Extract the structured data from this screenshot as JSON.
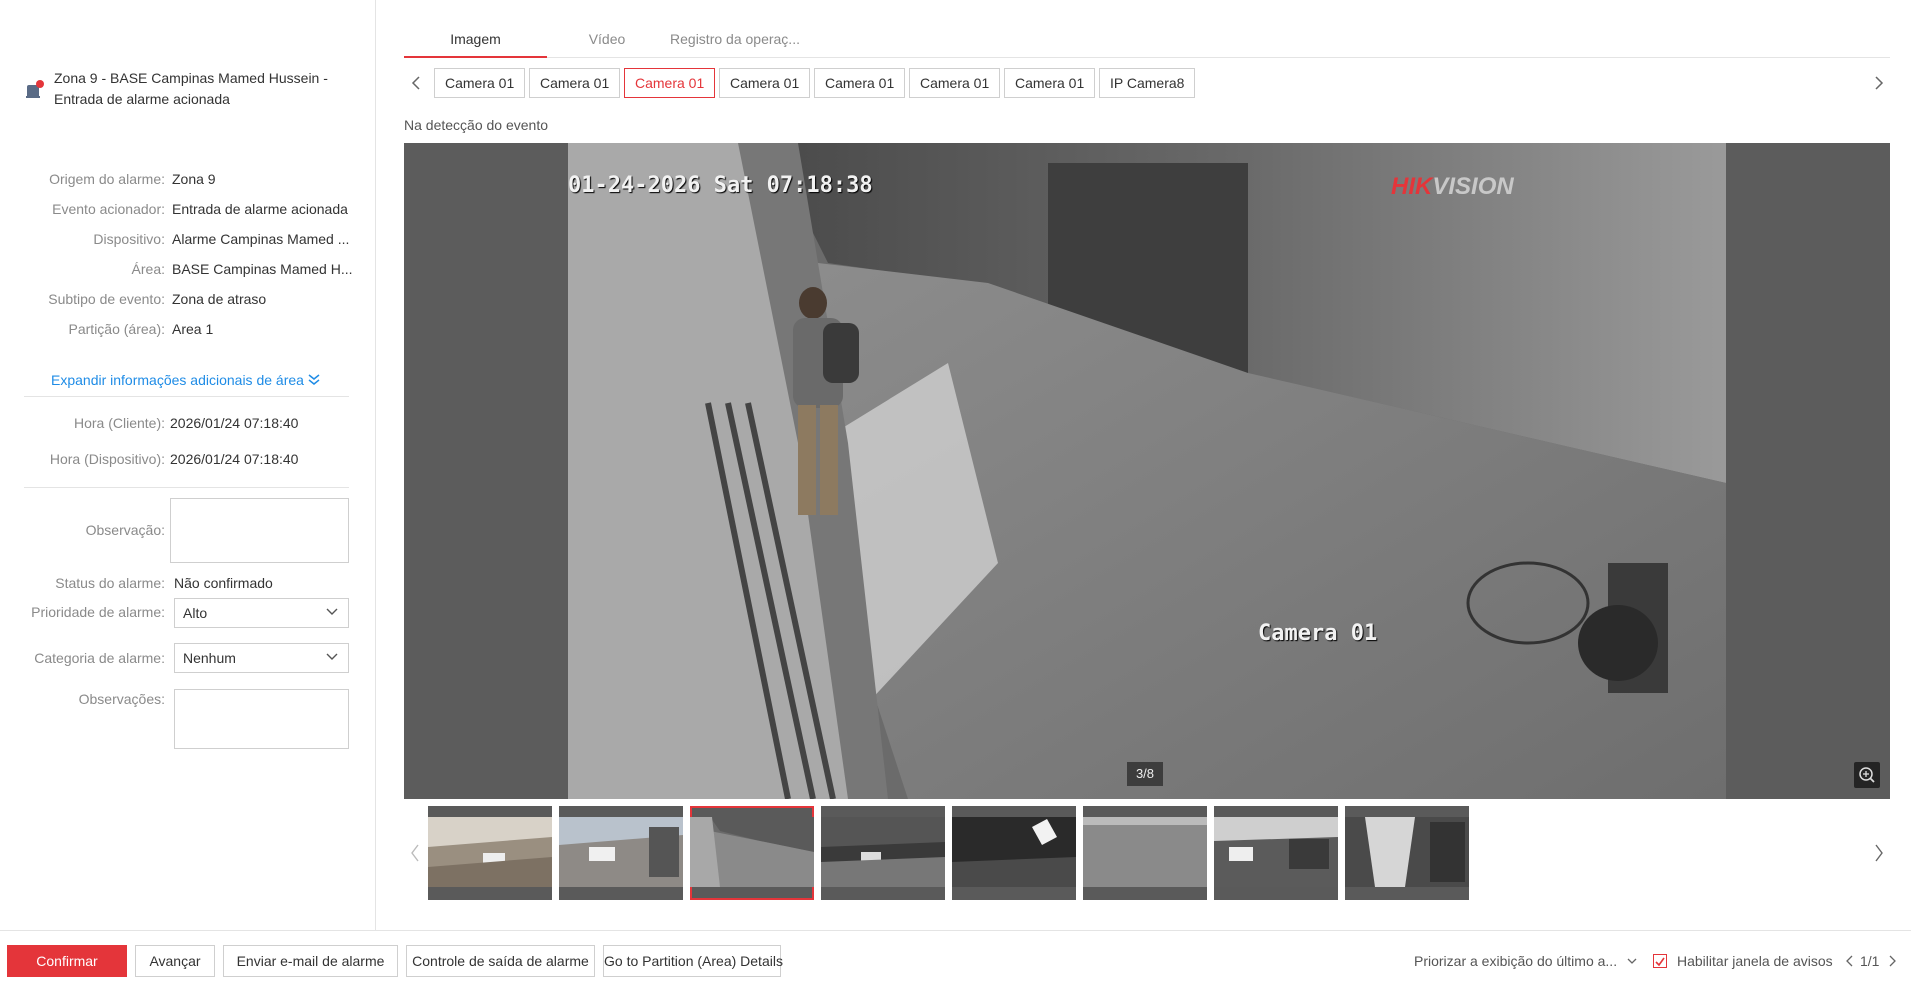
{
  "alarm": {
    "title_line1": "Zona 9 - BASE Campinas Mamed Hussein -",
    "title_line2": "Entrada de alarme acionada"
  },
  "details": [
    {
      "label": "Origem do alarme:",
      "value": "Zona 9"
    },
    {
      "label": "Evento acionador:",
      "value": "Entrada de alarme acionada"
    },
    {
      "label": "Dispositivo:",
      "value": "Alarme Campinas Mamed ..."
    },
    {
      "label": "Área:",
      "value": "BASE Campinas Mamed H..."
    },
    {
      "label": "Subtipo de evento:",
      "value": "Zona de atraso"
    },
    {
      "label": "Partição (área):",
      "value": "Area 1"
    }
  ],
  "expand_link": "Expandir informações adicionais de área",
  "times": [
    {
      "label": "Hora (Cliente):",
      "value": "2026/01/24 07:18:40"
    },
    {
      "label": "Hora (Dispositivo):",
      "value": "2026/01/24 07:18:40"
    }
  ],
  "form": {
    "observacao_label": "Observação:",
    "observacao_value": "",
    "status_label": "Status do alarme:",
    "status_value": "Não confirmado",
    "priority_label": "Prioridade de alarme:",
    "priority_value": "Alto",
    "category_label": "Categoria de alarme:",
    "category_value": "Nenhum",
    "notes_label": "Observações:",
    "notes_value": ""
  },
  "tabs": [
    {
      "label": "Imagem",
      "active": true
    },
    {
      "label": "Vídeo",
      "active": false
    },
    {
      "label": "Registro da operaç...",
      "active": false
    }
  ],
  "cameras": [
    {
      "label": "Camera 01",
      "active": false
    },
    {
      "label": "Camera 01",
      "active": false
    },
    {
      "label": "Camera 01",
      "active": true
    },
    {
      "label": "Camera 01",
      "active": false
    },
    {
      "label": "Camera 01",
      "active": false
    },
    {
      "label": "Camera 01",
      "active": false
    },
    {
      "label": "Camera 01",
      "active": false
    },
    {
      "label": "IP Camera8",
      "active": false
    }
  ],
  "viewer": {
    "event_label": "Na detecção do evento",
    "osd_timestamp": "01-24-2026 Sat 07:18:38",
    "osd_brand_red": "HIK",
    "osd_brand_rest": "VISION",
    "osd_camera": "Camera 01",
    "counter": "3/8"
  },
  "thumbnails": {
    "count": 8,
    "active_index": 2
  },
  "bottom": {
    "confirm": "Confirmar",
    "advance": "Avançar",
    "email": "Enviar e-mail de alarme",
    "exit_control": "Controle de saída de alarme",
    "partition": "Go to Partition (Area) Details",
    "priority_display": "Priorizar a exibição do último a...",
    "enable_popup": "Habilitar janela de avisos",
    "enable_popup_checked": true,
    "page": "1/1"
  },
  "colors": {
    "accent_red": "#e4353a",
    "link_blue": "#1f8ce6"
  }
}
